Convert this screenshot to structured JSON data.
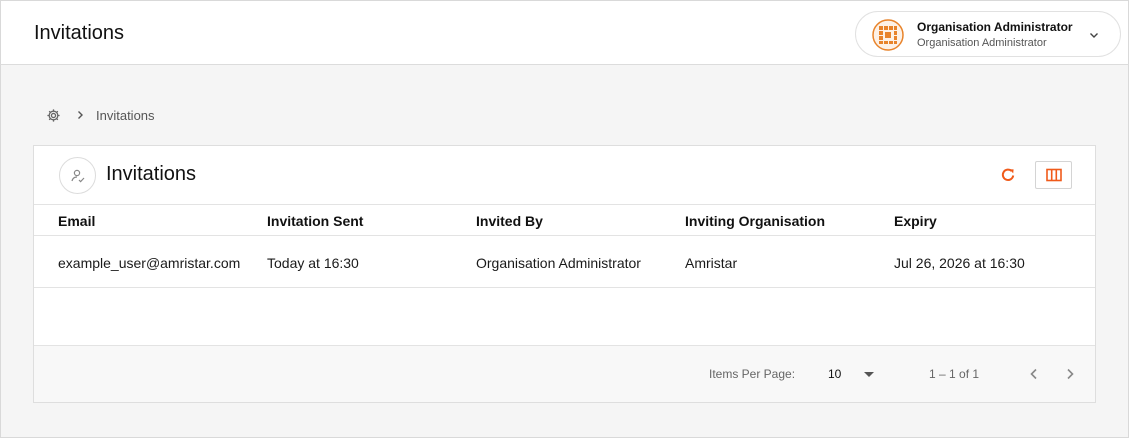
{
  "header": {
    "title": "Invitations",
    "account": {
      "name": "Organisation Administrator",
      "role": "Organisation Administrator",
      "avatar_icon": "waffle-logo-icon",
      "avatar_color": "#e8832a"
    }
  },
  "breadcrumb": {
    "home_icon": "gear-icon",
    "current": "Invitations"
  },
  "card": {
    "title": "Invitations",
    "icon": "user-check-icon",
    "accent_color": "#f05a1a"
  },
  "table": {
    "columns": [
      "Email",
      "Invitation Sent",
      "Invited By",
      "Inviting Organisation",
      "Expiry"
    ],
    "rows": [
      [
        "example_user@amristar.com",
        "Today at 16:30",
        "Organisation Administrator",
        "Amristar",
        "Jul 26, 2026 at 16:30"
      ]
    ]
  },
  "pagination": {
    "items_per_page_label": "Items Per Page:",
    "items_per_page": "10",
    "range": "1 – 1 of 1"
  }
}
